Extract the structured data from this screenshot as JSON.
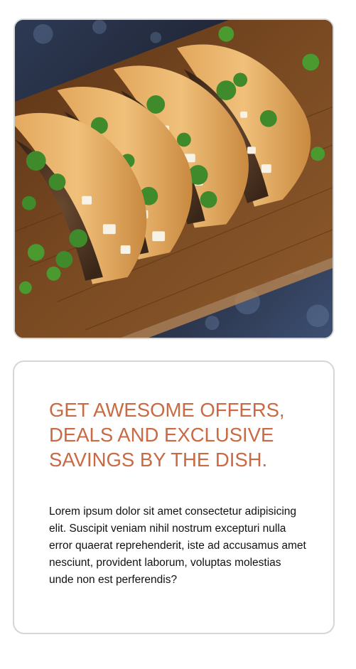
{
  "hero": {
    "image_alt": "Tacos on a wooden serving board with cilantro and onions"
  },
  "promo": {
    "headline": "GET AWESOME OFFERS, DEALS AND EXCLUSIVE SAVINGS BY THE DISH.",
    "body": "Lorem ipsum dolor sit amet consectetur adipisicing elit. Suscipit veniam nihil nostrum excepturi nulla error quaerat reprehenderit, iste ad accusamus amet nesciunt, provident laborum, voluptas molestias unde non est perferendis?",
    "headline_color": "#c96a45"
  }
}
